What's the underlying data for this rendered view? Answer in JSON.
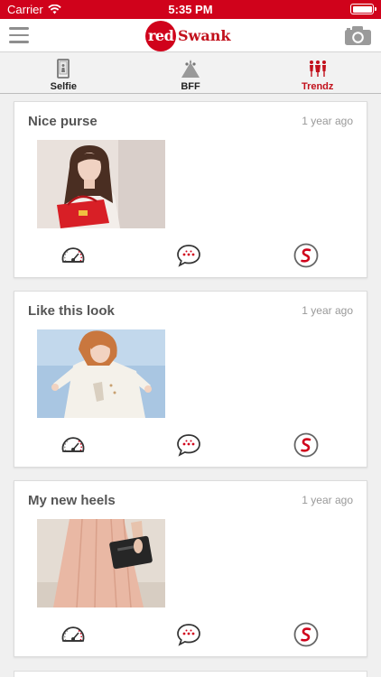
{
  "status_bar": {
    "carrier": "Carrier",
    "time": "5:35 PM"
  },
  "header": {
    "logo_red": "red",
    "logo_swank": "Swank"
  },
  "tabs": [
    {
      "label": "Selfie",
      "icon": "selfie-icon",
      "active": false
    },
    {
      "label": "BFF",
      "icon": "bff-icon",
      "active": false
    },
    {
      "label": "Trendz",
      "icon": "trendz-icon",
      "active": true
    }
  ],
  "posts": [
    {
      "title": "Nice purse",
      "time": "1 year ago",
      "image": "woman-with-red-purse-photo"
    },
    {
      "title": "Like this look",
      "time": "1 year ago",
      "image": "woman-in-white-blouse-photo"
    },
    {
      "title": "My new heels",
      "time": "1 year ago",
      "image": "pink-skirt-with-clutch-photo"
    }
  ],
  "colors": {
    "brand_red": "#d0021b",
    "logo_red": "#c2111c",
    "text_gray": "#555555",
    "time_gray": "#999999"
  },
  "action_icons": [
    "speedometer-icon",
    "chat-bubble-icon",
    "swank-s-icon"
  ]
}
